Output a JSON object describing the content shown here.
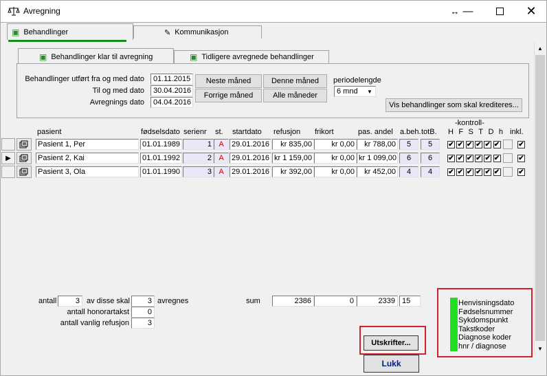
{
  "window": {
    "title": "Avregning",
    "app_icon": "scale-icon"
  },
  "tabs": {
    "outer": [
      "Behandlinger",
      "Kommunikasjon"
    ],
    "inner": [
      "Behandlinger klar til avregning",
      "Tidligere avregnede behandlinger"
    ]
  },
  "filter": {
    "from_label": "Behandlinger utført fra og med dato",
    "from_value": "01.11.2015",
    "to_label": "Til og med dato",
    "to_value": "30.04.2016",
    "avr_label": "Avregnings dato",
    "avr_value": "04.04.2016",
    "next_month": "Neste måned",
    "this_month": "Denne måned",
    "prev_month": "Forrige måned",
    "all_months": "Alle måneder",
    "period_label": "periodelengde",
    "period_value": "6 mnd",
    "credit_button": "Vis behandlinger som skal krediteres..."
  },
  "table": {
    "headers": {
      "pasient": "pasient",
      "fodselsdato": "fødselsdato",
      "serienr": "serienr",
      "st": "st.",
      "startdato": "startdato",
      "refusjon": "refusjon",
      "frikort": "frikort",
      "pas_andel": "pas. andel",
      "abeh": "a.beh.",
      "totb": "totB.",
      "kontroll": "-kontroll-",
      "kontroll_cols": [
        "H",
        "F",
        "S",
        "T",
        "D",
        "h"
      ],
      "inkl": "inkl."
    },
    "rows": [
      {
        "pasient": "Pasient 1, Per",
        "fodselsdato": "01.01.1989",
        "serienr": "1",
        "st": "A",
        "startdato": "29.01.2016",
        "refusjon": "kr 835,00",
        "frikort": "kr 0,00",
        "pas_andel": "kr 788,00",
        "abeh": "5",
        "totb": "5",
        "checks": "✔",
        "inkl": "✔",
        "current": false
      },
      {
        "pasient": "Pasient 2, Kai",
        "fodselsdato": "01.01.1992",
        "serienr": "2",
        "st": "A",
        "startdato": "29.01.2016",
        "refusjon": "kr 1 159,00",
        "frikort": "kr 0,00",
        "pas_andel": "kr 1 099,00",
        "abeh": "6",
        "totb": "6",
        "checks": "✔",
        "inkl": "✔",
        "current": true
      },
      {
        "pasient": "Pasient 3, Ola",
        "fodselsdato": "01.01.1990",
        "serienr": "3",
        "st": "A",
        "startdato": "29.01.2016",
        "refusjon": "kr 392,00",
        "frikort": "kr 0,00",
        "pas_andel": "kr 452,00",
        "abeh": "4",
        "totb": "4",
        "checks": "✔",
        "inkl": "✔",
        "current": false
      }
    ]
  },
  "summary": {
    "antall_label": "antall",
    "antall_value": "3",
    "av_disse_label": "av disse skal",
    "av_disse_value": "3",
    "avregnes_label": "avregnes",
    "honorar_label": "antall honorartakst",
    "honorar_value": "0",
    "vanlig_label": "antall vanlig refusjon",
    "vanlig_value": "3",
    "sum_label": "sum",
    "sum_refusjon": "2386",
    "sum_frikort": "0",
    "sum_pas_andel": "2339",
    "sum_beh": "15"
  },
  "buttons": {
    "utskrifter": "Utskrifter...",
    "lukk": "Lukk"
  },
  "legend": {
    "items": [
      "Henvisningsdato",
      "Fødselsnummer",
      "Sykdomspunkt",
      "Takstkoder",
      "Diagnose koder",
      "hnr / diagnose"
    ],
    "color": "#22dd22"
  },
  "colors": {
    "highlight_box": "#d0202a",
    "tab_underline": "#1a8a1a",
    "status_red": "#d00000"
  }
}
